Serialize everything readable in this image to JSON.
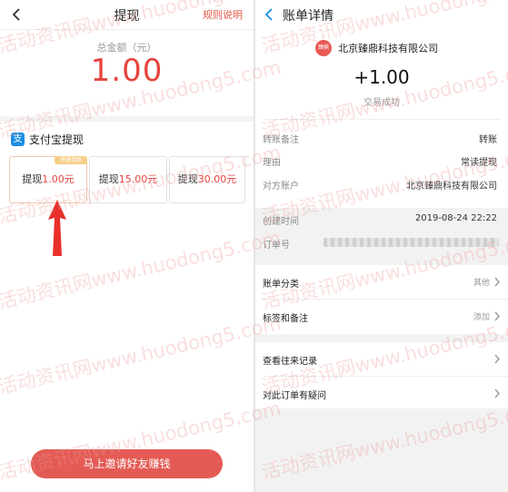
{
  "left": {
    "title": "提现",
    "rules_link": "规则说明",
    "total_label": "总金额（元）",
    "total_amount": "1.00",
    "alipay_label": "支付宝提现",
    "alipay_icon": "支",
    "options": [
      {
        "prefix": "提现",
        "amount": "1.00元",
        "tag": "快速到账"
      },
      {
        "prefix": "提现",
        "amount": "15.00元"
      },
      {
        "prefix": "提现",
        "amount": "30.00元"
      }
    ],
    "invite_button": "马上邀请好友赚钱"
  },
  "right": {
    "title": "账单详情",
    "merchant_logo": "臻鼎",
    "merchant": "北京臻鼎科技有限公司",
    "amount": "+1.00",
    "status": "交易成功",
    "rows": [
      {
        "key": "转账备注",
        "value": "转账"
      },
      {
        "key": "理由",
        "value": "常读提现"
      },
      {
        "key": "对方账户",
        "value": "北京臻鼎科技有限公司"
      },
      {
        "key": "创建时间",
        "value": "2019-08-24 22:22"
      },
      {
        "key": "订单号",
        "value": ""
      }
    ],
    "menu1": [
      {
        "label": "账单分类",
        "value": "其他"
      },
      {
        "label": "标签和备注",
        "value": "添加"
      }
    ],
    "menu2": [
      {
        "label": "查看往来记录",
        "value": ""
      },
      {
        "label": "对此订单有疑问",
        "value": ""
      }
    ]
  },
  "watermark": {
    "text": "活动资讯网www.huodong5.com"
  },
  "colors": {
    "accent_red": "#e6443d",
    "alipay_blue": "#1c8fe3",
    "link_blue": "#1a8ee0",
    "button_red": "#e45b55"
  }
}
